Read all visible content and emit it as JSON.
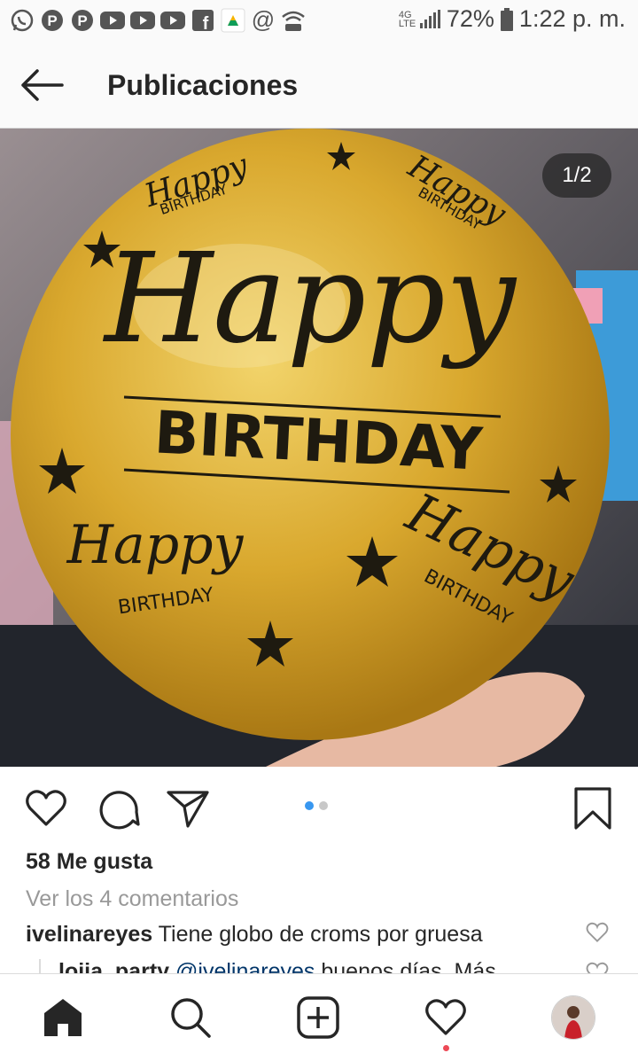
{
  "status_bar": {
    "notification_icons": [
      "whatsapp-icon",
      "pinterest-icon",
      "pinterest-icon",
      "youtube-icon",
      "youtube-icon",
      "youtube-icon",
      "facebook-icon",
      "drive-icon",
      "at-icon",
      "hotspot-icon"
    ],
    "network": "4G LTE",
    "battery": "72%",
    "time": "1:22 p. m."
  },
  "header": {
    "back_icon": "arrow-left-icon",
    "title": "Publicaciones"
  },
  "post": {
    "image_counter": "1/2",
    "image": {
      "print_large_script": "Happy",
      "print_large_caps": "BIRTHDAY",
      "print_small_script": "Happy",
      "print_small_caps": "BIRTHDAY",
      "balloon_color": "#d6a62c"
    },
    "carousel": {
      "total": 2,
      "active": 1
    },
    "likes": "58 Me gusta",
    "view_comments": "Ver los 4 comentarios",
    "comment": {
      "user": "ivelinareyes",
      "text": "Tiene globo de croms por gruesa"
    },
    "reply": {
      "user": "loija_party",
      "mention": "@ivelinareyes",
      "text": "buenos días. Más"
    }
  },
  "nav": {
    "items": [
      "home-icon",
      "search-icon",
      "new-post-icon",
      "activity-icon",
      "profile-icon"
    ],
    "active": "home-icon",
    "notification_color": "#ed4956"
  },
  "colors": {
    "accent_blue": "#3897f0",
    "text": "#262626",
    "muted": "#999999"
  }
}
